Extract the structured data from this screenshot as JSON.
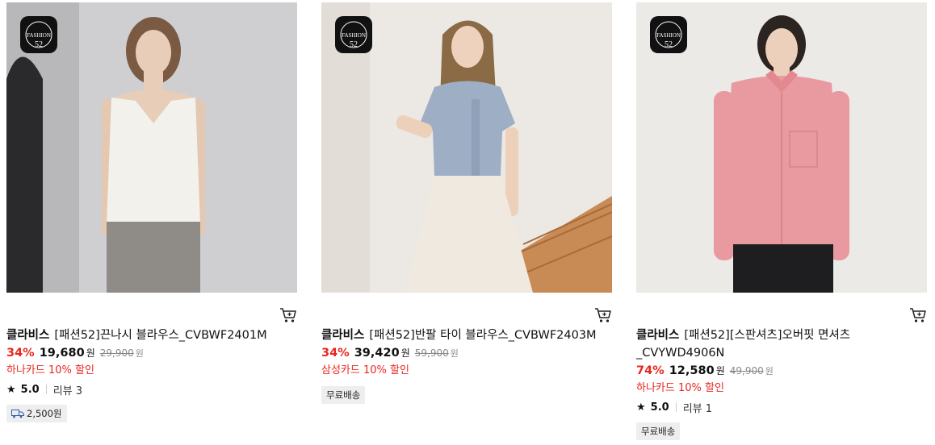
{
  "products": [
    {
      "brand": "클라비스",
      "name": "[패션52]끈나시 블라우스_CVBWF2401M",
      "discount": "34%",
      "price": "19,680",
      "price_unit": "원",
      "original_price": "29,900",
      "original_unit": "원",
      "card_promo": "하나카드 10% 할인",
      "rating": "5.0",
      "review": "리뷰 3",
      "shipping": "2,500원",
      "badge_text": "FASHION"
    },
    {
      "brand": "클라비스",
      "name": "[패션52]반팔 타이 블라우스_CVBWF2403M",
      "discount": "34%",
      "price": "39,420",
      "price_unit": "원",
      "original_price": "59,900",
      "original_unit": "원",
      "card_promo": "삼성카드 10% 할인",
      "shipping": "무료배송",
      "badge_text": "FASHION"
    },
    {
      "brand": "클라비스",
      "name": "[패션52][스판셔츠]오버핏 면셔츠 _CVYWD4906N",
      "discount": "74%",
      "price": "12,580",
      "price_unit": "원",
      "original_price": "49,900",
      "original_unit": "원",
      "card_promo": "하나카드 10% 할인",
      "rating": "5.0",
      "review": "리뷰 1",
      "shipping": "무료배송",
      "badge_text": "FASHION"
    }
  ],
  "icons": {
    "cart": "cart-icon",
    "star": "star-icon",
    "truck": "truck-icon"
  },
  "colors": {
    "discount": "#e8281f",
    "badge_bg": "#111111"
  }
}
